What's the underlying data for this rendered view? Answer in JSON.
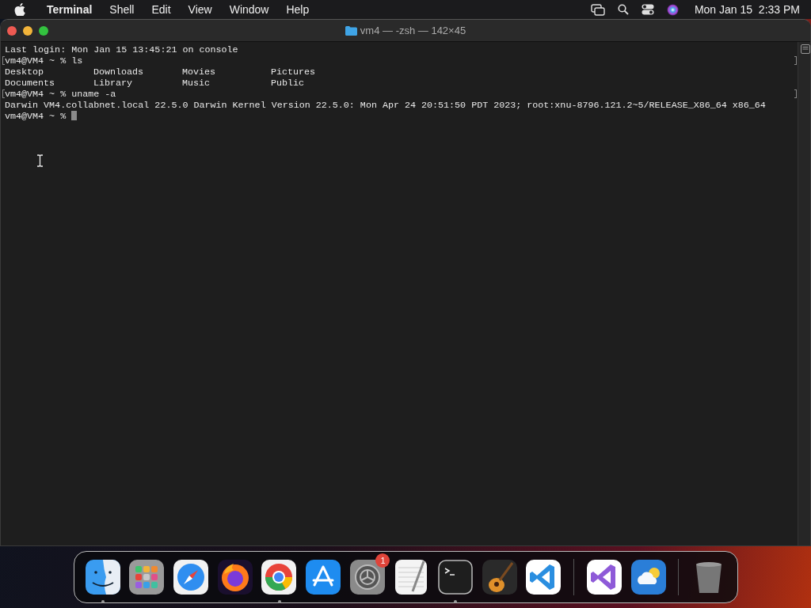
{
  "menu_bar": {
    "app": "Terminal",
    "menus": [
      "Shell",
      "Edit",
      "View",
      "Window",
      "Help"
    ],
    "clock": "Mon Jan 15  2:33 PM"
  },
  "window": {
    "title": "vm4 — -zsh — 142×45"
  },
  "terminal": {
    "lines": [
      {
        "kind": "text",
        "text": "Last login: Mon Jan 15 13:45:21 on console",
        "marked": false
      },
      {
        "kind": "text",
        "text": "vm4@VM4 ~ % ls",
        "marked": true
      },
      {
        "kind": "columns",
        "cells": [
          "Desktop",
          "Downloads",
          "Movies",
          "Pictures"
        ],
        "marked": false
      },
      {
        "kind": "columns",
        "cells": [
          "Documents",
          "Library",
          "Music",
          "Public"
        ],
        "marked": false
      },
      {
        "kind": "text",
        "text": "vm4@VM4 ~ % uname -a",
        "marked": true
      },
      {
        "kind": "text",
        "text": "Darwin VM4.collabnet.local 22.5.0 Darwin Kernel Version 22.5.0: Mon Apr 24 20:51:50 PDT 2023; root:xnu-8796.121.2~5/RELEASE_X86_64 x86_64",
        "marked": false
      },
      {
        "kind": "prompt",
        "text": "vm4@VM4 ~ % ",
        "marked": false
      }
    ]
  },
  "dock": {
    "items": [
      {
        "kind": "finder",
        "running": true
      },
      {
        "kind": "launchpad",
        "running": false
      },
      {
        "kind": "safari",
        "running": false
      },
      {
        "kind": "firefox",
        "running": false
      },
      {
        "kind": "chrome",
        "running": true
      },
      {
        "kind": "appstore",
        "running": false
      },
      {
        "kind": "settings",
        "running": false,
        "badge": "1"
      },
      {
        "kind": "textedit",
        "running": false
      },
      {
        "kind": "terminal",
        "running": true
      },
      {
        "kind": "garageband",
        "running": false
      },
      {
        "kind": "vscode",
        "running": false
      },
      {
        "kind": "separator"
      },
      {
        "kind": "visualstudio",
        "running": false
      },
      {
        "kind": "weather",
        "running": false
      },
      {
        "kind": "separator"
      },
      {
        "kind": "trash",
        "running": false
      }
    ]
  }
}
